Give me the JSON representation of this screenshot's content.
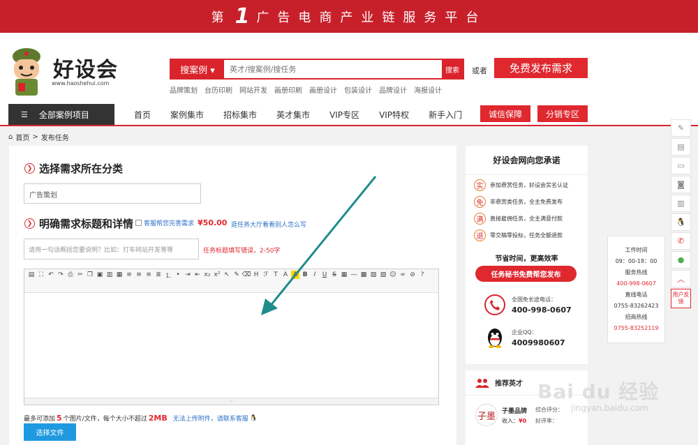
{
  "banner": {
    "pre": "第",
    "num": "1",
    "post": "广告电商产业链服务平台"
  },
  "logo": {
    "brand": "好设会",
    "url": "www.haoshehui.com"
  },
  "search": {
    "category": "搜案例 ▾",
    "placeholder": "英才/搜案例/搜任务",
    "button": "搜索"
  },
  "or_text": "或者",
  "publish_button": "免费发布需求",
  "hotwords": [
    "品牌策划",
    "台历印刷",
    "网站开发",
    "画册印刷",
    "画册设计",
    "包装设计",
    "品牌设计",
    "海报设计"
  ],
  "nav": {
    "all_cases": "全部案例项目",
    "links": [
      "首页",
      "案例集市",
      "招标集市",
      "英才集市",
      "VIP专区",
      "VIP特权",
      "新手入门"
    ],
    "btn1": "诚信保障",
    "btn2": "分销专区"
  },
  "breadcrumb": {
    "home": "首页",
    "sep": ">",
    "current": "发布任务"
  },
  "form": {
    "section1": "选择需求所在分类",
    "category_value": "广告策划",
    "section2": "明确需求标题和详情",
    "assist_label": "客服帮您完善需求",
    "assist_price": "¥50.00",
    "hint_link": "逛任务大厅看看别人怎么写",
    "title_placeholder": "请用一句话概括您要说明？比如：打车网站开发等等",
    "title_error": "任务标题填写错误，2-50字",
    "upload_pre": "最多可添加",
    "upload_count": "5",
    "upload_mid": "个图片/文件，每个大小不超过",
    "upload_size": "2MB",
    "upload_link": "无法上传附件，请联系客服",
    "choose_file": "选择文件"
  },
  "side": {
    "title": "好设会网向您承诺",
    "promises": [
      {
        "icon": "实",
        "text": "参加悬赏任务，好设会实名认证"
      },
      {
        "icon": "免",
        "text": "非悬赏类任务，全主免费发布"
      },
      {
        "icon": "满",
        "text": "直接雇佣任务，全主满意付款"
      },
      {
        "icon": "退",
        "text": "零交稿零投标，任务全额退款"
      }
    ],
    "efficiency": "节省时间，更高效率",
    "secretary_button": "任务秘书免费帮您发布",
    "phone_label": "全国免长途电话：",
    "phone_value": "400-998-0607",
    "qq_label": "企业QQ：",
    "qq_value": "4009980607"
  },
  "talent": {
    "title": "推荐英才",
    "avatar_text": "子墨",
    "name": "子墨品牌",
    "score_label": "综合评分：",
    "income_label": "收入：",
    "income_value": "¥0",
    "score2": "好评率：",
    "stars": 0
  },
  "hotline": {
    "work_label": "工作时间",
    "work_time": "09：00-18：00",
    "service_label": "服务热线",
    "service_num": "400-998-0607",
    "direct_label": "直线电话",
    "direct_num": "0755-83262423",
    "biz_label": "招商热线",
    "biz_num": "0755-83252119"
  },
  "feedback": "用户反馈",
  "watermark": {
    "main": "Bai du 经验",
    "sub": "jingyan.baidu.com"
  },
  "colors": {
    "brand_red": "#d9242c",
    "link_blue": "#2b6fc8",
    "upload_blue": "#1f9ae0"
  }
}
